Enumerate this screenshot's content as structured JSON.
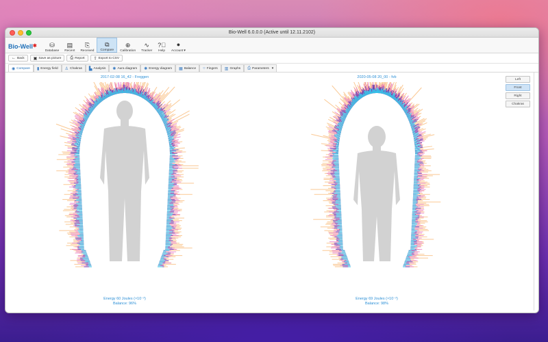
{
  "window": {
    "title": "Bio-Well 6.0.0.0 (Active until 12.11.2102)"
  },
  "logo": {
    "text": "Bio-Well"
  },
  "toolbar": {
    "items": [
      {
        "label": "Database",
        "icon": "database-icon"
      },
      {
        "label": "Recent",
        "icon": "recent-icon"
      },
      {
        "label": "Received",
        "icon": "inbox-icon"
      },
      {
        "label": "Compare",
        "icon": "compare-icon",
        "active": true
      },
      {
        "label": "Calibration",
        "icon": "calibration-icon"
      },
      {
        "label": "Tracker",
        "icon": "tracker-icon"
      },
      {
        "label": "Help",
        "icon": "help-icon"
      },
      {
        "label": "Account",
        "icon": "account-icon"
      }
    ]
  },
  "actions": {
    "back": "Back",
    "save_picture": "Save as picture",
    "report": "Report",
    "export_csv": "Export to CSV"
  },
  "tabs": [
    {
      "label": "Compare",
      "active": true
    },
    {
      "label": "Energy field"
    },
    {
      "label": "Chakras"
    },
    {
      "label": "Analysis"
    },
    {
      "label": "Aura diagram"
    },
    {
      "label": "Energy diagram"
    },
    {
      "label": "Balance"
    },
    {
      "label": "Fingers"
    },
    {
      "label": "Graphs"
    },
    {
      "label": "Parameters"
    }
  ],
  "left_panel": {
    "date": "2017-02-08 16_42 - Freggen",
    "energy": "Energy 60 Joules (×10⁻²)",
    "balance": "Balance: 96%"
  },
  "right_panel": {
    "date": "2020-05-08 20_00 - fvb",
    "energy": "Energy 69 Joules (×10⁻²)",
    "balance": "Balance: 98%"
  },
  "view_buttons": {
    "left": "Left",
    "front": "Front",
    "right": "Right",
    "chakras": "Chakras"
  },
  "colors": {
    "accent": "#2b8fd6",
    "aura_cyan": "#2fd0f0",
    "aura_violet": "#4a1fb0",
    "aura_orange": "#f59a3a",
    "figure": "#d2d2d2"
  }
}
